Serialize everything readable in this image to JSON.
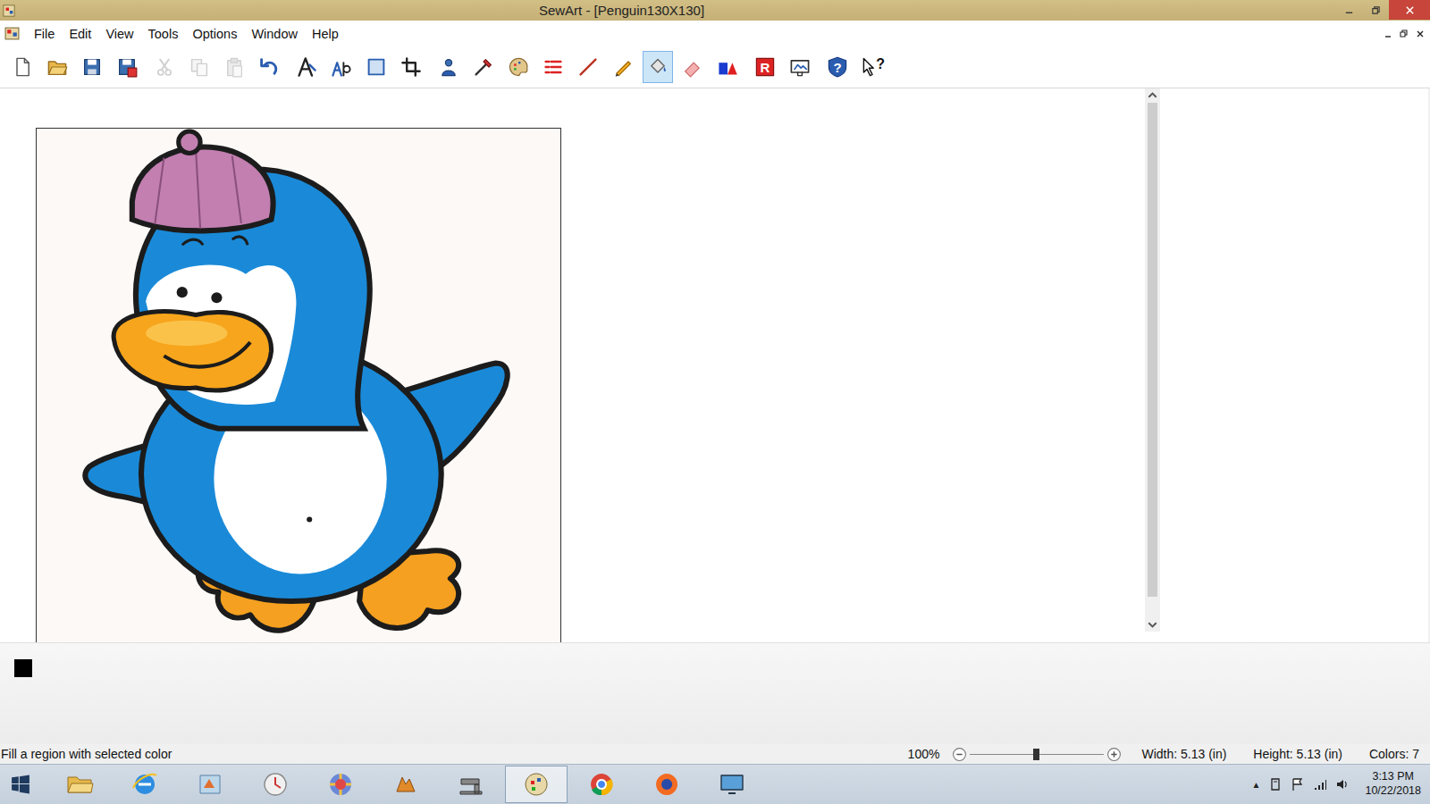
{
  "window": {
    "title": "SewArt - [Penguin130X130]"
  },
  "menu": [
    {
      "label": "File"
    },
    {
      "label": "Edit"
    },
    {
      "label": "View"
    },
    {
      "label": "Tools"
    },
    {
      "label": "Options"
    },
    {
      "label": "Window"
    },
    {
      "label": "Help"
    }
  ],
  "toolbar": {
    "groups": [
      [
        {
          "kind": "new",
          "disabled": false,
          "selected": false
        },
        {
          "kind": "open",
          "disabled": false,
          "selected": false
        },
        {
          "kind": "save",
          "disabled": false,
          "selected": false
        },
        {
          "kind": "save-all",
          "disabled": false,
          "selected": false
        }
      ],
      [
        {
          "kind": "cut",
          "disabled": true,
          "selected": false
        },
        {
          "kind": "copy",
          "disabled": true,
          "selected": false
        },
        {
          "kind": "paste",
          "disabled": true,
          "selected": false
        },
        {
          "kind": "undo",
          "disabled": false,
          "selected": false
        }
      ],
      [
        {
          "kind": "trace",
          "disabled": false,
          "selected": false
        },
        {
          "kind": "wizard",
          "disabled": false,
          "selected": false
        },
        {
          "kind": "select",
          "disabled": false,
          "selected": false
        },
        {
          "kind": "crop",
          "disabled": false,
          "selected": false
        }
      ],
      [
        {
          "kind": "stamp",
          "disabled": false,
          "selected": false
        },
        {
          "kind": "tool",
          "disabled": false,
          "selected": false
        },
        {
          "kind": "palette",
          "disabled": false,
          "selected": false
        },
        {
          "kind": "list",
          "disabled": false,
          "selected": false
        },
        {
          "kind": "line",
          "disabled": false,
          "selected": false
        },
        {
          "kind": "pencil",
          "disabled": false,
          "selected": false
        },
        {
          "kind": "fill",
          "disabled": false,
          "selected": true
        },
        {
          "kind": "eraser",
          "disabled": false,
          "selected": false
        },
        {
          "kind": "shapes",
          "disabled": false,
          "selected": false
        }
      ],
      [
        {
          "kind": "reduce",
          "disabled": false,
          "selected": false,
          "glyph": "R"
        },
        {
          "kind": "resize",
          "disabled": false,
          "selected": false
        }
      ],
      [
        {
          "kind": "help",
          "disabled": false,
          "selected": false,
          "glyph": "?"
        },
        {
          "kind": "whats-this",
          "disabled": false,
          "selected": false,
          "glyph": "?"
        }
      ]
    ]
  },
  "scrollbar": {
    "level": 0.96
  },
  "palette": [
    {
      "color": "#000000"
    }
  ],
  "status_bar": {
    "hint": "Fill a region with selected color",
    "zoom": "100%",
    "zoom_level": 0.5,
    "width": "Width: 5.13 (in)",
    "height": "Height: 5.13 (in)",
    "colors": "Colors: 7"
  },
  "taskbar": {
    "apps": [
      {
        "kind": "explorer",
        "active": false
      },
      {
        "kind": "ie",
        "active": false
      },
      {
        "kind": "app-a",
        "active": false
      },
      {
        "kind": "app-b",
        "active": false
      },
      {
        "kind": "app-c",
        "active": false
      },
      {
        "kind": "app-d",
        "active": false
      },
      {
        "kind": "sewing",
        "active": false
      },
      {
        "kind": "sewart",
        "active": true
      },
      {
        "kind": "chrome",
        "active": false
      },
      {
        "kind": "firefox",
        "active": false
      },
      {
        "kind": "screen",
        "active": false
      }
    ],
    "tray_toggle": "▲",
    "clock": {
      "time": "3:13 PM",
      "date": "10/22/2018"
    }
  }
}
